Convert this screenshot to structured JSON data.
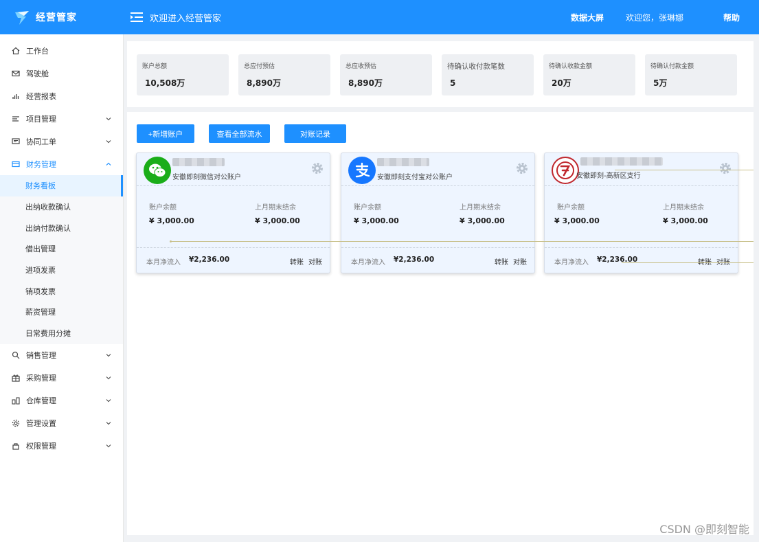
{
  "header": {
    "brand": "经营管家",
    "title": "欢迎进入经营管家",
    "dashboard": "数据大屏",
    "user_greeting": "欢迎您，张琳娜",
    "help": "帮助"
  },
  "sidebar": {
    "items": [
      {
        "label": "工作台",
        "icon": "home-icon"
      },
      {
        "label": "驾驶舱",
        "icon": "mail-icon"
      },
      {
        "label": "经营报表",
        "icon": "chart-icon"
      },
      {
        "label": "项目管理",
        "icon": "list-icon"
      },
      {
        "label": "协同工单",
        "icon": "message-icon"
      },
      {
        "label": "财务管理",
        "icon": "wallet-icon"
      },
      {
        "label": "销售管理",
        "icon": "sales-icon"
      },
      {
        "label": "采购管理",
        "icon": "gift-icon"
      },
      {
        "label": "仓库管理",
        "icon": "warehouse-icon"
      },
      {
        "label": "管理设置",
        "icon": "settings-icon"
      },
      {
        "label": "权限管理",
        "icon": "lock-icon"
      }
    ],
    "finance_sub": [
      "财务看板",
      "出纳收款确认",
      "出纳付款确认",
      "借出管理",
      "进项发票",
      "销项发票",
      "薪资管理",
      "日常费用分摊"
    ]
  },
  "stats": [
    {
      "label": "账户总额",
      "value": "10,508万"
    },
    {
      "label": "总应付预估",
      "value": "8,890万"
    },
    {
      "label": "总应收预估",
      "value": "8,890万"
    },
    {
      "label": "待确认收付款笔数",
      "value": "5"
    },
    {
      "label": "待确认收款金额",
      "value": "20万"
    },
    {
      "label": "待确认付款金额",
      "value": "5万"
    }
  ],
  "buttons": {
    "add_account": "+新增账户",
    "view_all": "查看全部流水",
    "reconcile_log": "对账记录"
  },
  "accounts": [
    {
      "name": "安徽即刻微信对公账户",
      "logo": "wechat-icon",
      "balance_label": "账户余额",
      "balance": "¥ 3,000.00",
      "last_label": "上月期末结余",
      "last": "¥ 3,000.00",
      "inflow_label": "本月净流入",
      "inflow": "¥2,236.00",
      "transfer": "转账",
      "reconcile": "对账"
    },
    {
      "name": "安徽即刻支付宝对公账户",
      "logo": "alipay-icon",
      "balance_label": "账户余额",
      "balance": "¥ 3,000.00",
      "last_label": "上月期末结余",
      "last": "¥ 3,000.00",
      "inflow_label": "本月净流入",
      "inflow": "¥2,236.00",
      "transfer": "转账",
      "reconcile": "对账"
    },
    {
      "name": "安徽即刻-高新区支行",
      "logo": "bank-icon",
      "balance_label": "账户余额",
      "balance": "¥ 3,000.00",
      "last_label": "上月期末结余",
      "last": "¥ 3,000.00",
      "inflow_label": "本月净流入",
      "inflow": "¥2,236.00",
      "transfer": "转账",
      "reconcile": "对账"
    }
  ],
  "watermark": "CSDN @即刻智能",
  "colors": {
    "primary": "#1e90ff",
    "wechat": "#1aad19",
    "alipay": "#1677ff",
    "bank": "#c0272d"
  }
}
